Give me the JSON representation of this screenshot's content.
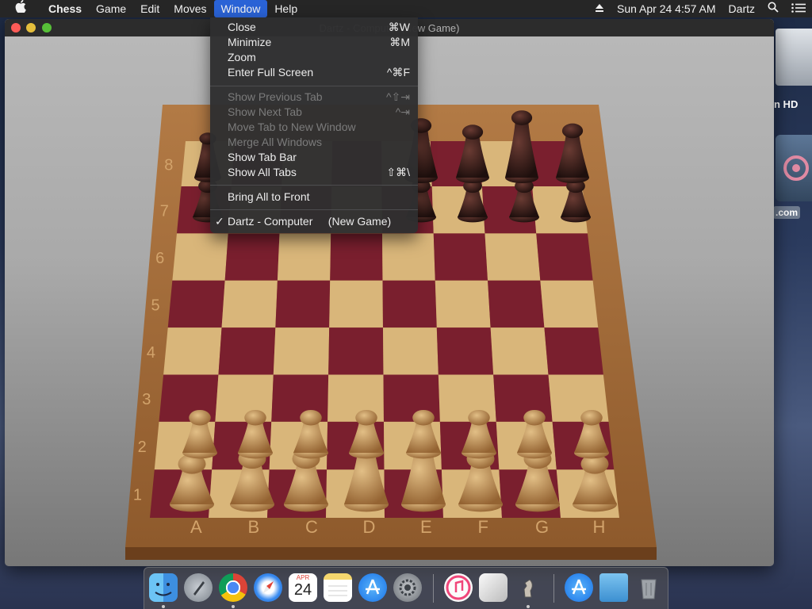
{
  "menubar": {
    "apple": "",
    "items": [
      "Chess",
      "Game",
      "Edit",
      "Moves",
      "Window",
      "Help"
    ],
    "date_time": "Sun Apr 24  4:57 AM",
    "user": "Dartz"
  },
  "window": {
    "title": "Dartz - Computer  (New Game)"
  },
  "window_menu": {
    "close": {
      "label": "Close",
      "shortcut": "⌘W"
    },
    "minimize": {
      "label": "Minimize",
      "shortcut": "⌘M"
    },
    "zoom": {
      "label": "Zoom"
    },
    "full_screen": {
      "label": "Enter Full Screen",
      "shortcut": "^⌘F"
    },
    "prev_tab": {
      "label": "Show Previous Tab",
      "shortcut": "^⇧⇥"
    },
    "next_tab": {
      "label": "Show Next Tab",
      "shortcut": "^⇥"
    },
    "move_tab": {
      "label": "Move Tab to New Window"
    },
    "merge": {
      "label": "Merge All Windows"
    },
    "tab_bar": {
      "label": "Show Tab Bar"
    },
    "all_tabs": {
      "label": "Show All Tabs",
      "shortcut": "⇧⌘\\"
    },
    "bring_front": {
      "label": "Bring All to Front"
    },
    "game_window": {
      "label": "Dartz - Computer     (New Game)",
      "check": "✓"
    }
  },
  "board": {
    "files": [
      "A",
      "B",
      "C",
      "D",
      "E",
      "F",
      "G",
      "H"
    ],
    "ranks": [
      "1",
      "2",
      "3",
      "4",
      "5",
      "6",
      "7",
      "8"
    ]
  },
  "desktop": {
    "disk_label": "n HD",
    "app_label": ".com"
  },
  "dock": {
    "calendar_month": "APR",
    "calendar_day": "24"
  },
  "colors": {
    "menu_highlight": "#2a63d6",
    "dark_square": "#7a1f2e",
    "light_square": "#d9b67a",
    "board_frame": "#a0683a"
  }
}
